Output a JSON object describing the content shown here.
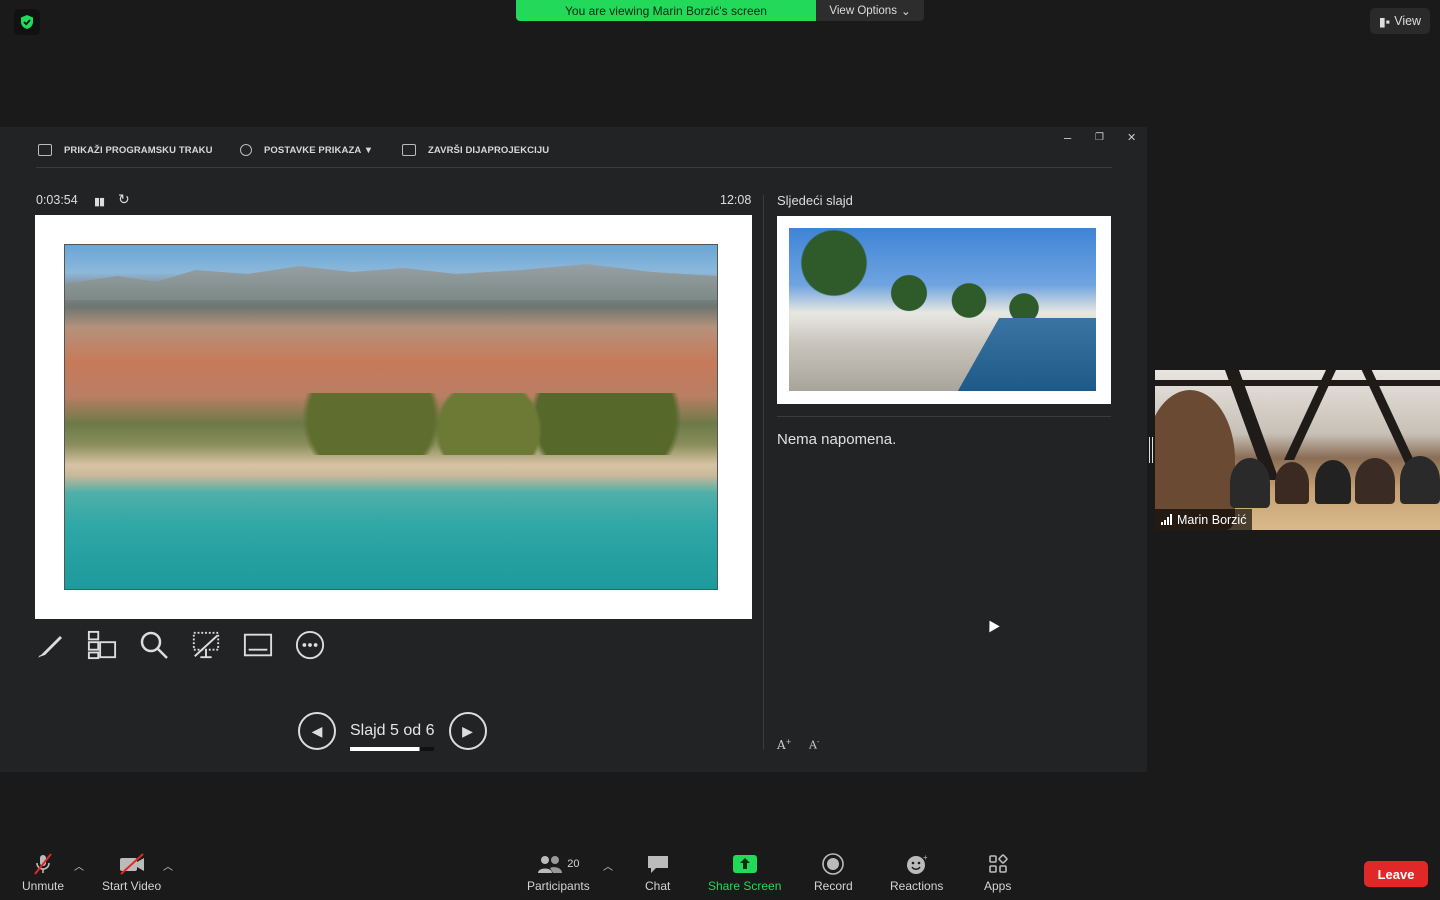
{
  "banner": {
    "text": "You are viewing Marin Borzić's screen",
    "view_options": "View Options"
  },
  "view_button": "View",
  "presenter": {
    "toolbar": [
      {
        "label": "PRIKAŽI PROGRAMSKU TRAKU",
        "icon": "taskbar-icon"
      },
      {
        "label": "POSTAVKE PRIKAZA ▼",
        "icon": "display-settings-icon"
      },
      {
        "label": "ZAVRŠI DIJAPROJEKCIJU",
        "icon": "end-slideshow-icon"
      }
    ],
    "window_controls": {
      "minimize": "–",
      "restore": "❐",
      "close": "✕"
    },
    "timer": "0:03:54",
    "clock": "12:08",
    "next_slide_header": "Sljedeći slajd",
    "notes": "Nema napomena.",
    "slide_counter": "Slajd 5 od 6",
    "slide_progress": 0.83
  },
  "participant": {
    "name": "Marin Borzić"
  },
  "bottom_bar": {
    "unmute": "Unmute",
    "start_video": "Start Video",
    "participants": "Participants",
    "participants_count": "20",
    "chat": "Chat",
    "share_screen": "Share Screen",
    "record": "Record",
    "reactions": "Reactions",
    "apps": "Apps",
    "leave": "Leave"
  },
  "colors": {
    "share_green": "#23d959",
    "leave_red": "#e02828"
  }
}
